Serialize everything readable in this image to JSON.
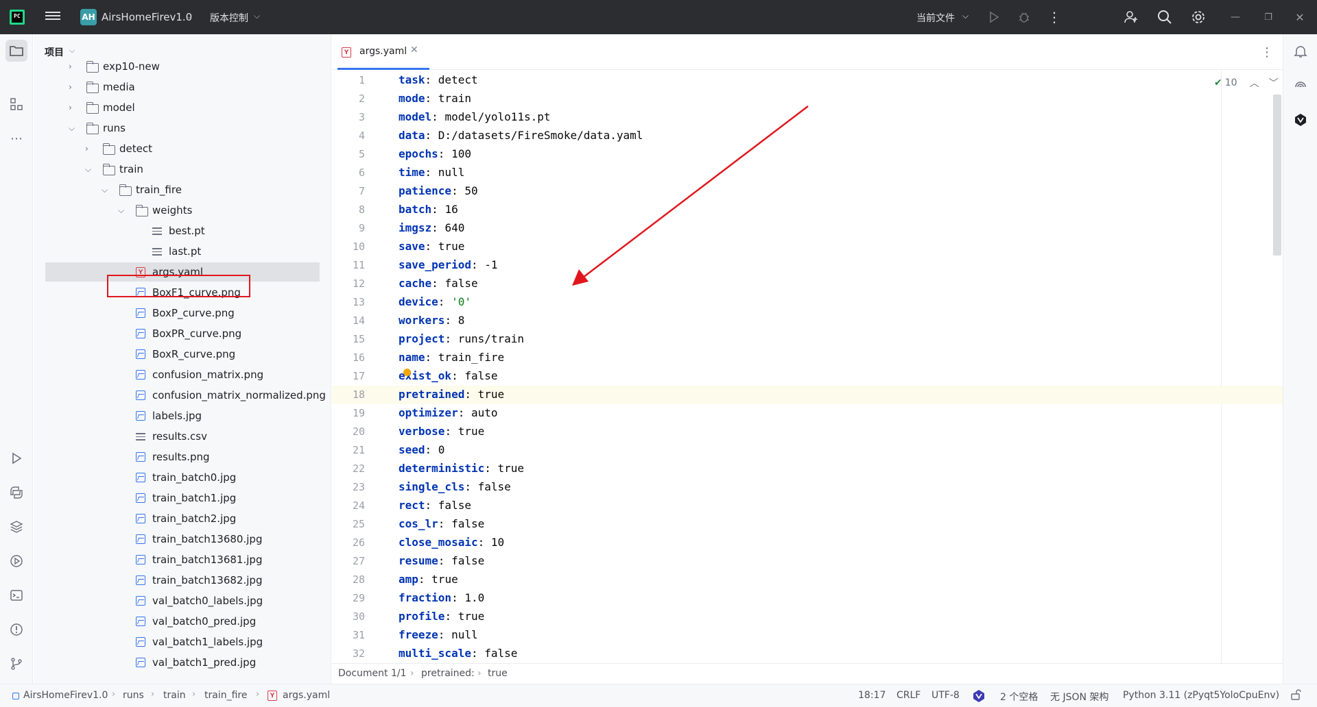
{
  "titlebar": {
    "project_badge": "AH",
    "project_name": "AirsHomeFirev1.0",
    "vcs_label": "版本控制",
    "current_file_label": "当前文件"
  },
  "project_panel": {
    "header": "项目",
    "tree": [
      {
        "label": "exp10-new",
        "type": "folder",
        "expanded": false
      },
      {
        "label": "media",
        "type": "folder",
        "expanded": false
      },
      {
        "label": "model",
        "type": "folder",
        "expanded": false
      },
      {
        "label": "runs",
        "type": "folder",
        "expanded": true
      },
      {
        "label": "detect",
        "type": "folder",
        "expanded": false
      },
      {
        "label": "train",
        "type": "folder",
        "expanded": true
      },
      {
        "label": "train_fire",
        "type": "folder",
        "expanded": true
      },
      {
        "label": "weights",
        "type": "folder",
        "expanded": true
      },
      {
        "label": "best.pt",
        "type": "file"
      },
      {
        "label": "last.pt",
        "type": "file"
      },
      {
        "label": "args.yaml",
        "type": "yaml",
        "selected": true
      },
      {
        "label": "BoxF1_curve.png",
        "type": "image"
      },
      {
        "label": "BoxP_curve.png",
        "type": "image"
      },
      {
        "label": "BoxPR_curve.png",
        "type": "image"
      },
      {
        "label": "BoxR_curve.png",
        "type": "image"
      },
      {
        "label": "confusion_matrix.png",
        "type": "image"
      },
      {
        "label": "confusion_matrix_normalized.png",
        "type": "image"
      },
      {
        "label": "labels.jpg",
        "type": "image"
      },
      {
        "label": "results.csv",
        "type": "file"
      },
      {
        "label": "results.png",
        "type": "image"
      },
      {
        "label": "train_batch0.jpg",
        "type": "image"
      },
      {
        "label": "train_batch1.jpg",
        "type": "image"
      },
      {
        "label": "train_batch2.jpg",
        "type": "image"
      },
      {
        "label": "train_batch13680.jpg",
        "type": "image"
      },
      {
        "label": "train_batch13681.jpg",
        "type": "image"
      },
      {
        "label": "train_batch13682.jpg",
        "type": "image"
      },
      {
        "label": "val_batch0_labels.jpg",
        "type": "image"
      },
      {
        "label": "val_batch0_pred.jpg",
        "type": "image"
      },
      {
        "label": "val_batch1_labels.jpg",
        "type": "image"
      },
      {
        "label": "val_batch1_pred.jpg",
        "type": "image"
      }
    ]
  },
  "editor": {
    "tab_label": "args.yaml",
    "inspection_count": "10",
    "current_line": 18,
    "lines": [
      {
        "key": "task",
        "value": "detect"
      },
      {
        "key": "mode",
        "value": "train"
      },
      {
        "key": "model",
        "value": "model/yolo11s.pt"
      },
      {
        "key": "data",
        "value": "D:/datasets/FireSmoke/data.yaml"
      },
      {
        "key": "epochs",
        "value": "100"
      },
      {
        "key": "time",
        "value": "null"
      },
      {
        "key": "patience",
        "value": "50"
      },
      {
        "key": "batch",
        "value": "16"
      },
      {
        "key": "imgsz",
        "value": "640"
      },
      {
        "key": "save",
        "value": "true"
      },
      {
        "key": "save_period",
        "value": "-1"
      },
      {
        "key": "cache",
        "value": "false"
      },
      {
        "key": "device",
        "value": "'0'",
        "string": true
      },
      {
        "key": "workers",
        "value": "8"
      },
      {
        "key": "project",
        "value": "runs/train"
      },
      {
        "key": "name",
        "value": "train_fire"
      },
      {
        "key": "exist_ok",
        "value": "false"
      },
      {
        "key": "pretrained",
        "value": "true"
      },
      {
        "key": "optimizer",
        "value": "auto"
      },
      {
        "key": "verbose",
        "value": "true"
      },
      {
        "key": "seed",
        "value": "0"
      },
      {
        "key": "deterministic",
        "value": "true"
      },
      {
        "key": "single_cls",
        "value": "false"
      },
      {
        "key": "rect",
        "value": "false"
      },
      {
        "key": "cos_lr",
        "value": "false"
      },
      {
        "key": "close_mosaic",
        "value": "10"
      },
      {
        "key": "resume",
        "value": "false"
      },
      {
        "key": "amp",
        "value": "true"
      },
      {
        "key": "fraction",
        "value": "1.0"
      },
      {
        "key": "profile",
        "value": "true"
      },
      {
        "key": "freeze",
        "value": "null"
      },
      {
        "key": "multi_scale",
        "value": "false"
      }
    ]
  },
  "breadcrumb_bar": {
    "document": "Document 1/1",
    "key": "pretrained:",
    "value": "true"
  },
  "statusbar": {
    "path": [
      "AirsHomeFirev1.0",
      "runs",
      "train",
      "train_fire",
      "args.yaml"
    ],
    "position": "18:17",
    "line_ending": "CRLF",
    "encoding": "UTF-8",
    "indent": "2 个空格",
    "schema": "无 JSON 架构",
    "interpreter": "Python 3.11 (zPyqt5YoloCpuEnv)"
  },
  "colors": {
    "accent": "#3574f0",
    "annotation_red": "#e0161d",
    "keyword": "#0033b3",
    "string": "#067d17"
  }
}
